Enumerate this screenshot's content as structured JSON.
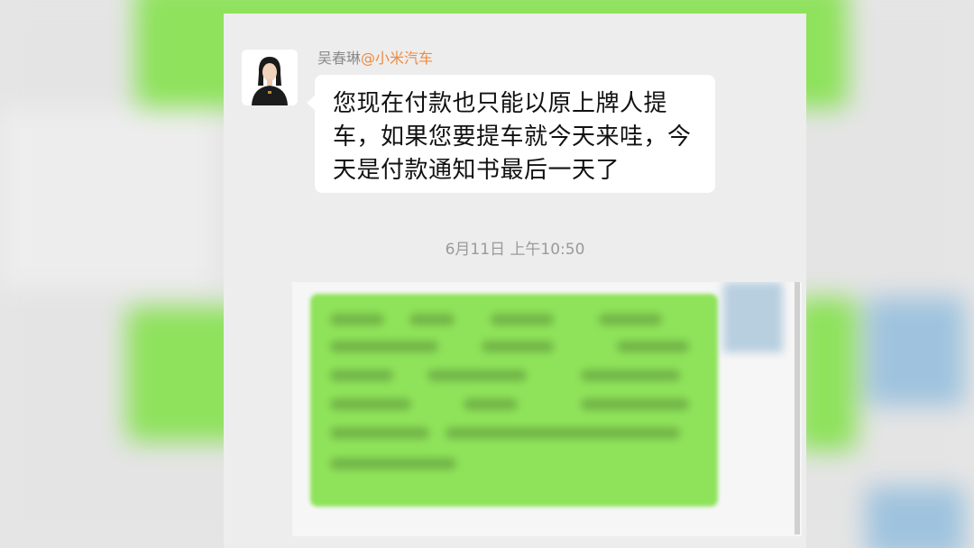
{
  "chat": {
    "sender_name": "吴春琳",
    "sender_company": "@小米汽车",
    "message_line1": "您现在付款也只能以原上牌人提",
    "message_line2": "车，如果您要提车就今天来哇，今",
    "message_line3": "天是付款通知书最后一天了",
    "timestamp": "6月11日 上午10:50"
  },
  "icons": {
    "sender_avatar": "person-avatar-icon",
    "self_avatar": "blurred-avatar-icon"
  },
  "colors": {
    "outgoing_bubble": "#8fe35a",
    "incoming_bubble": "#ffffff",
    "sender_company": "#f08a3c",
    "chat_background": "#ededed"
  }
}
